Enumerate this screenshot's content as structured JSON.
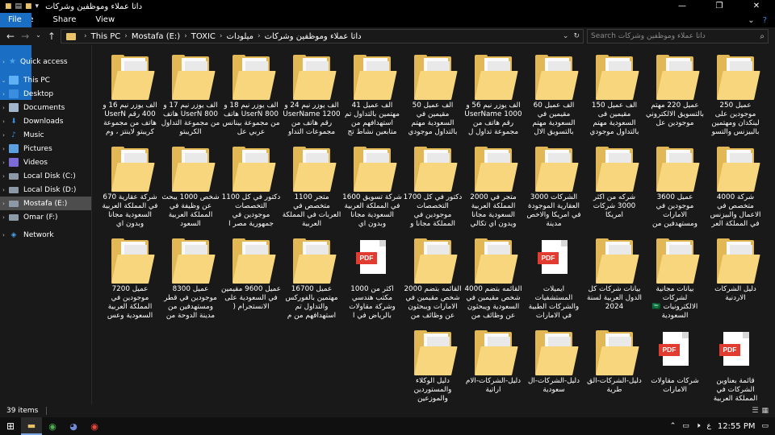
{
  "window": {
    "title": "داتا عملاء وموظفين وشركات",
    "controls": [
      "—",
      "❐",
      "✕"
    ]
  },
  "ribbon": {
    "tabs": [
      "File",
      "Home",
      "Share",
      "View"
    ]
  },
  "address": {
    "crumbs": [
      "This PC",
      "Mostafa (E:)",
      "TOXIC",
      "ميلودات",
      "داتا عملاء وموظفين وشركات"
    ],
    "search_placeholder": "Search داتا عملاء وموظفين وشركات"
  },
  "sidebar": {
    "items": [
      {
        "label": "Quick access",
        "icon": "star-icon",
        "color": "#4aa3f0"
      },
      {
        "label": "This PC",
        "icon": "pc-icon",
        "color": "#5fb1f5"
      },
      {
        "label": "Desktop",
        "icon": "desktop-icon",
        "color": "#3b8de0"
      },
      {
        "label": "Documents",
        "icon": "documents-icon",
        "color": "#9fb6cc"
      },
      {
        "label": "Downloads",
        "icon": "downloads-icon",
        "color": "#3b8de0"
      },
      {
        "label": "Music",
        "icon": "music-icon",
        "color": "#3b8de0"
      },
      {
        "label": "Pictures",
        "icon": "pictures-icon",
        "color": "#5aa0e0"
      },
      {
        "label": "Videos",
        "icon": "videos-icon",
        "color": "#7b6bd6"
      },
      {
        "label": "Local Disk (C:)",
        "icon": "drive-icon",
        "color": "#9aa"
      },
      {
        "label": "Local Disk (D:)",
        "icon": "drive-icon",
        "color": "#9aa"
      },
      {
        "label": "Mostafa (E:)",
        "icon": "drive-icon",
        "color": "#9aa"
      },
      {
        "label": "Omar (F:)",
        "icon": "drive-icon",
        "color": "#9aa"
      },
      {
        "label": "Network",
        "icon": "network-icon",
        "color": "#4aa3f0"
      }
    ]
  },
  "files": [
    {
      "type": "folder",
      "label": "عميل 250 موجودين على لينكدان ومهتمين بالبيزنس والتسو"
    },
    {
      "type": "folder",
      "label": "عميل 220 مهتم بالتسويق الالكتروني موجودين عل"
    },
    {
      "type": "folder",
      "label": "الف عميل 150 مقيمين فى السعودية مهتم بالتداول موجودي"
    },
    {
      "type": "folder",
      "label": "الف عميل 60 مقيمين في السعودية مهتم بالتسويق الال"
    },
    {
      "type": "folder",
      "label": "الف يوزر نيم 56 و 1000 UserName رقم هاتف من مجموعة تداول ل"
    },
    {
      "type": "folder",
      "label": "الف عميل 50 مقيمين في السعودية مهتم بالتداول موجودي"
    },
    {
      "type": "folder",
      "label": "الف عميل 41 مهتمين بالتداول تم استهدافهم من متابعين نشاط تج"
    },
    {
      "type": "folder",
      "label": "الف يوزر نيم 24 و 1200 UserName رقم هاتف من مجموعات التداو"
    },
    {
      "type": "folder",
      "label": "الف يوزر نيم 18 و 800 UserN هاتف من مجموعة بينانس عربي عل"
    },
    {
      "type": "folder",
      "label": "الف يوزر نيم 17 و 800 UserN هاتف من مجموعة التداول الكريبتو"
    },
    {
      "type": "folder",
      "label": "الف يوزر نيم 16 و 400 رقم UserN هاتف من مجموعة كريبتو لاينتز ، وم"
    },
    {
      "type": "folder",
      "label": "شركة 4000 متخصص في الاعمال والبيزنس في المملكة العر"
    },
    {
      "type": "folder",
      "label": "عميل 3600 موجودين في الامارات ومستهدفين من"
    },
    {
      "type": "folder",
      "label": "شركه من اكثر 3000 شركات امريكا"
    },
    {
      "type": "folder",
      "label": "الشركات 3000 العقارية الموجودة في امريكا والاخص مدينة"
    },
    {
      "type": "folder",
      "label": "متجر في 2000 المملكة العربية السعودية مجانا ويدون اي تكالي"
    },
    {
      "type": "folder",
      "label": "دكتور في كل 1700 التخصصات موجودين في المملكة مجانا و"
    },
    {
      "type": "folder",
      "label": "شركة تسويق 1600 في المملكة العربية السعودية مجانا وبدون اي"
    },
    {
      "type": "folder",
      "label": "متجر 1100 متخصص في العربات في المملكة العربية"
    },
    {
      "type": "folder",
      "label": "دكتور في كل 1100 التخصصات موجودين في جمهورية مصر ا"
    },
    {
      "type": "folder",
      "label": "شخص 1000 يبحث عن وظيفة في المملكة العربية السعود"
    },
    {
      "type": "folder",
      "label": "شركة عقارية 670 في المملكة العربية السعودية مجانا وبدون اي"
    },
    {
      "type": "folder",
      "label": "دليل الشركات الاردنية"
    },
    {
      "type": "folder",
      "label": "بيانات مجانية لشركات الالكترونيات 🇸🇦 السعودية"
    },
    {
      "type": "folder",
      "label": "بيانات شركات كل الدول العربية لسنة 2024"
    },
    {
      "type": "pdf",
      "label": "ايميلات المستشفيات والشركات الطبية في الامارات"
    },
    {
      "type": "folder",
      "label": "القائمه بتضم 4000 شخص مقيمين في السعودية ويبحثون عن وظائف من"
    },
    {
      "type": "folder",
      "label": "القائمه بتضم 2000 شخص مقيمين في الامارات ويبحثون عن وظائف من"
    },
    {
      "type": "pdf",
      "label": "أكثر من 1000 مكتب هندسي وشركة مقاولات بالرياض في ا"
    },
    {
      "type": "folder",
      "label": "عميل 16700 مهتمين بالفوركس والتداول تم استهدافهم من م"
    },
    {
      "type": "folder",
      "label": "عميل 9600 مقيمين في السعودية على الانستجرام ("
    },
    {
      "type": "folder",
      "label": "عميل 8300 موجودين في قطر ومستهدفين من مدينة الدوحة من"
    },
    {
      "type": "folder",
      "label": "عميل 7200 موجودين في المملكة العربية السعودية وعس"
    },
    {
      "type": "pdf",
      "label": "قائمة بعناوين الشركات في المملكة العربية"
    },
    {
      "type": "pdf",
      "label": "شركات مقاولات الامارات"
    },
    {
      "type": "folder",
      "label": "دليل-الشركات-الق طرية"
    },
    {
      "type": "folder",
      "label": "دليل-الشركات-ال سعودية"
    },
    {
      "type": "folder",
      "label": "دليل-الشركات-الام اراتية"
    },
    {
      "type": "folder",
      "label": "دليل الوكلاء والمستوردين والموزعين"
    }
  ],
  "status": {
    "count": "39 items"
  },
  "taskbar": {
    "time": "12:55 PM",
    "lang": "ع"
  },
  "colors": {
    "accent": "#1a6fc4",
    "folder": "#e2b856",
    "pdf": "#e23b2f"
  }
}
